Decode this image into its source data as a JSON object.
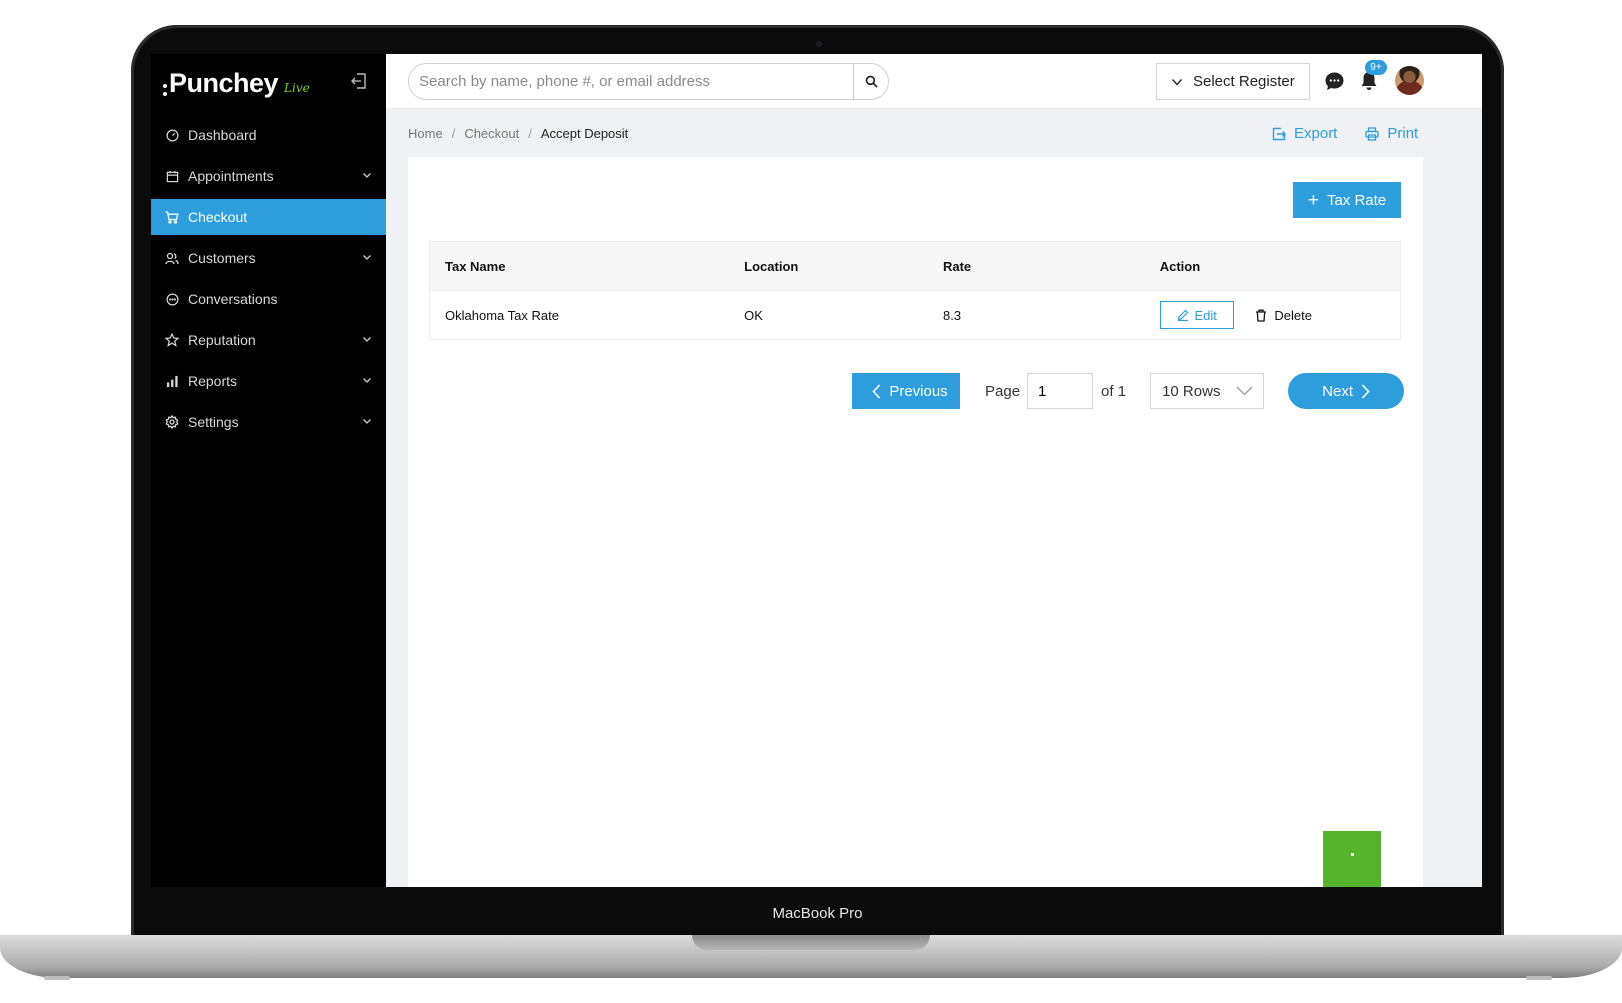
{
  "app": {
    "brand": "Punchey",
    "brand_suffix": "Live",
    "device_label": "MacBook Pro"
  },
  "sidebar": {
    "items": [
      {
        "label": "Dashboard",
        "icon": "dashboard-gauge-icon",
        "has_submenu": false,
        "active": false
      },
      {
        "label": "Appointments",
        "icon": "calendar-icon",
        "has_submenu": true,
        "active": false
      },
      {
        "label": "Checkout",
        "icon": "cart-icon",
        "has_submenu": false,
        "active": true
      },
      {
        "label": "Customers",
        "icon": "customers-icon",
        "has_submenu": true,
        "active": false
      },
      {
        "label": "Conversations",
        "icon": "chat-bubble-icon",
        "has_submenu": false,
        "active": false
      },
      {
        "label": "Reputation",
        "icon": "star-icon",
        "has_submenu": true,
        "active": false
      },
      {
        "label": "Reports",
        "icon": "bar-chart-icon",
        "has_submenu": true,
        "active": false
      },
      {
        "label": "Settings",
        "icon": "gear-icon",
        "has_submenu": true,
        "active": false
      }
    ]
  },
  "topbar": {
    "search_placeholder": "Search by name, phone #, or email address",
    "register_label": "Select Register",
    "notification_badge": "9+"
  },
  "breadcrumb": {
    "items": [
      "Home",
      "Checkout",
      "Accept Deposit"
    ]
  },
  "actions": {
    "export_label": "Export",
    "print_label": "Print",
    "add_label": "Tax Rate"
  },
  "table": {
    "columns": [
      "Tax Name",
      "Location",
      "Rate",
      "Action"
    ],
    "rows": [
      {
        "tax_name": "Oklahoma Tax Rate",
        "location": "OK",
        "rate": "8.3",
        "edit_label": "Edit",
        "delete_label": "Delete"
      }
    ]
  },
  "pagination": {
    "previous_label": "Previous",
    "page_label": "Page",
    "current_page": "1",
    "of_label": "of 1",
    "rows_label": "10 Rows",
    "next_label": "Next"
  },
  "colors": {
    "accent": "#2d9ddc",
    "sidebar_bg": "#000000",
    "fab": "#55b42b",
    "brand_live": "#7bd13a"
  }
}
